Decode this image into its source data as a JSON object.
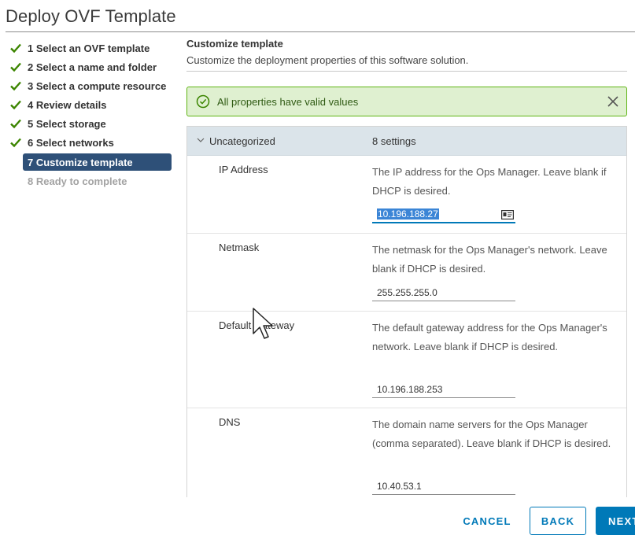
{
  "window": {
    "title": "Deploy OVF Template"
  },
  "steps": [
    {
      "label": "1 Select an OVF template",
      "state": "done"
    },
    {
      "label": "2 Select a name and folder",
      "state": "done"
    },
    {
      "label": "3 Select a compute resource",
      "state": "done"
    },
    {
      "label": "4 Review details",
      "state": "done"
    },
    {
      "label": "5 Select storage",
      "state": "done"
    },
    {
      "label": "6 Select networks",
      "state": "done"
    },
    {
      "label": "7 Customize template",
      "state": "active"
    },
    {
      "label": "8 Ready to complete",
      "state": "disabled"
    }
  ],
  "main": {
    "title": "Customize template",
    "subtitle": "Customize the deployment properties of this software solution."
  },
  "alert": {
    "text": "All properties have valid values",
    "icon": "check-circle-icon"
  },
  "group": {
    "name": "Uncategorized",
    "count": "8 settings"
  },
  "properties": [
    {
      "label": "IP Address",
      "description": "The IP address for the Ops Manager. Leave blank if DHCP is desired.",
      "value": "10.196.188.27"
    },
    {
      "label": "Netmask",
      "description": "The netmask for the Ops Manager's network. Leave blank if DHCP is desired.",
      "value": "255.255.255.0"
    },
    {
      "label": "Default Gateway",
      "description": "The default gateway address for the Ops Manager's network. Leave blank if DHCP is desired.",
      "value": "10.196.188.253"
    },
    {
      "label": "DNS",
      "description": "The domain name servers for the Ops Manager (comma separated). Leave blank if DHCP is desired.",
      "value": "10.40.53.1"
    }
  ],
  "buttons": {
    "cancel": "CANCEL",
    "back": "BACK",
    "next": "NEXT"
  },
  "colors": {
    "accent": "#0079b8",
    "active_step": "#2e5078",
    "success": "#60b515"
  }
}
